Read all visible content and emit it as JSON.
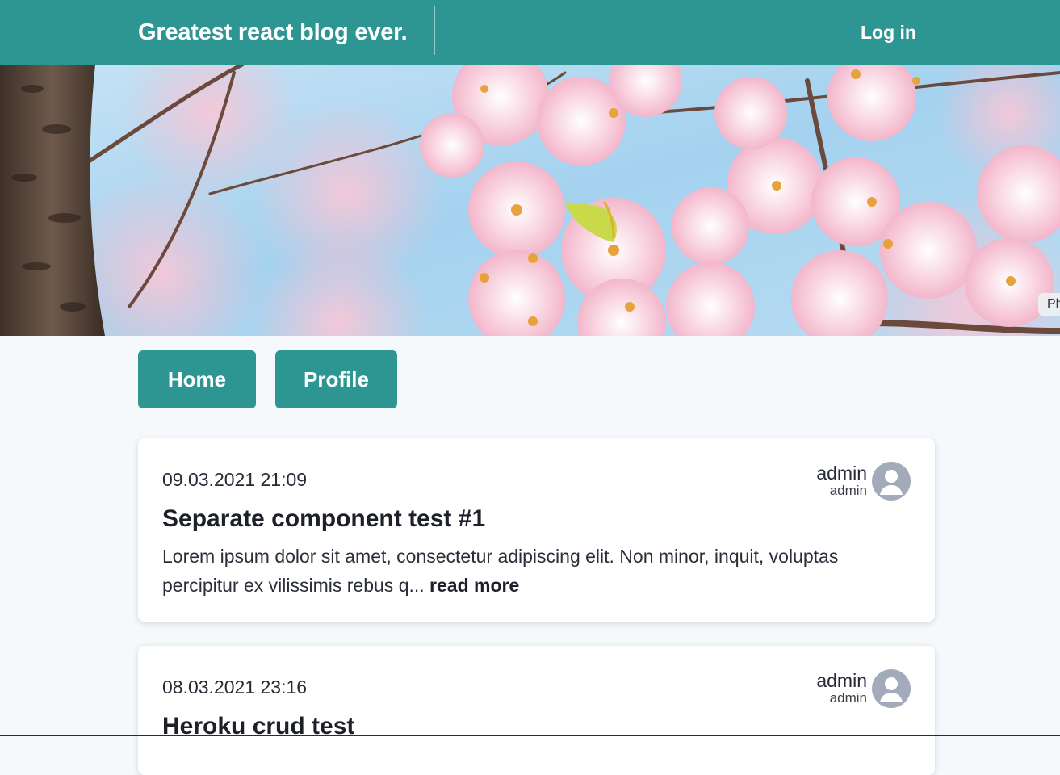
{
  "header": {
    "brand": "Greatest react blog ever.",
    "login_label": "Log in"
  },
  "hero": {
    "photo_credit": "Ph"
  },
  "nav": {
    "home_label": "Home",
    "profile_label": "Profile"
  },
  "posts": [
    {
      "date": "09.03.2021 21:09",
      "title": "Separate component test #1",
      "excerpt": "Lorem ipsum dolor sit amet, consectetur adipiscing elit. Non minor, inquit, voluptas percipitur ex vilissimis rebus q...",
      "read_more": "read more",
      "author_name": "admin",
      "author_username": "admin"
    },
    {
      "date": "08.03.2021 23:16",
      "title": "Heroku crud test",
      "author_name": "admin",
      "author_username": "admin"
    }
  ],
  "colors": {
    "accent": "#2e9692",
    "avatar": "#a3abba",
    "background": "#f5f9fb"
  },
  "icons": {
    "avatar": "user-avatar-icon"
  }
}
